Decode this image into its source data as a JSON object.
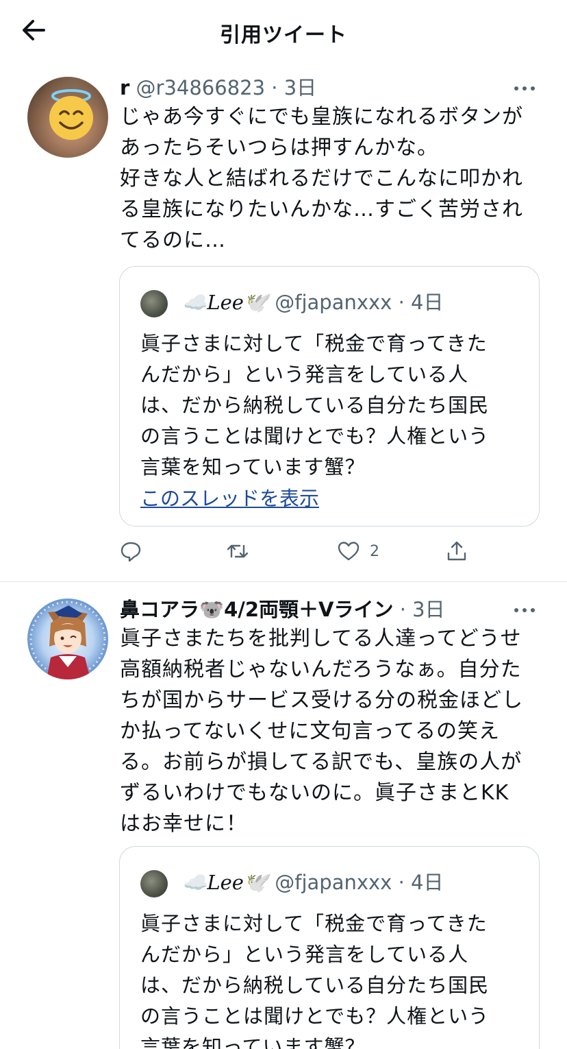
{
  "header": {
    "title": "引用ツイート"
  },
  "tweets": [
    {
      "name": "r",
      "handle": "@r34866823",
      "time": "3日",
      "avatar_emoji": "😇",
      "text": [
        "じゃあ今すぐにでも皇族になれるボタンが",
        "あったらそいつらは押すんかな。",
        "好きな人と結ばれるだけでこんなに叩かれ",
        "る皇族になりたいんかな…すごく苦労され",
        "てるのに…"
      ],
      "quote": {
        "name": "☁️𝐿𝑒𝑒🕊️",
        "handle": "@fjapanxxx",
        "time": "4日",
        "text": [
          "眞子さまに対して「税金で育ってきた",
          "んだから」という発言をしている人",
          "は、だから納税している自分たち国民",
          "の言うことは聞けとでも？人権という",
          "言葉を知っています蟹？"
        ],
        "thread_link": "このスレッドを表示"
      },
      "actions": {
        "reply": "",
        "retweet": "",
        "like": "2",
        "share": ""
      }
    },
    {
      "name": "鼻コアラ🐨4/2両顎＋Vライン",
      "handle": "",
      "time": "3日",
      "text": [
        "眞子さまたちを批判してる人達ってどうせ",
        "高額納税者じゃないんだろうなぁ。自分た",
        "ちが国からサービス受ける分の税金ほどし",
        "か払ってないくせに文句言ってるの笑え",
        "る。お前らが損してる訳でも、皇族の人が",
        "ずるいわけでもないのに。眞子さまとKK",
        "はお幸せに！"
      ],
      "quote": {
        "name": "☁️𝐿𝑒𝑒🕊️",
        "handle": "@fjapanxxx",
        "time": "4日",
        "text": [
          "眞子さまに対して「税金で育ってきた",
          "んだから」という発言をしている人",
          "は、だから納税している自分たち国民",
          "の言うことは聞けとでも？人権という",
          "言葉を知っています蟹？"
        ]
      }
    }
  ],
  "separator": "·",
  "colors": {
    "text": "#0f1419",
    "secondary": "#536471",
    "border": "#cfd9de",
    "link": "#1d4b9a"
  }
}
